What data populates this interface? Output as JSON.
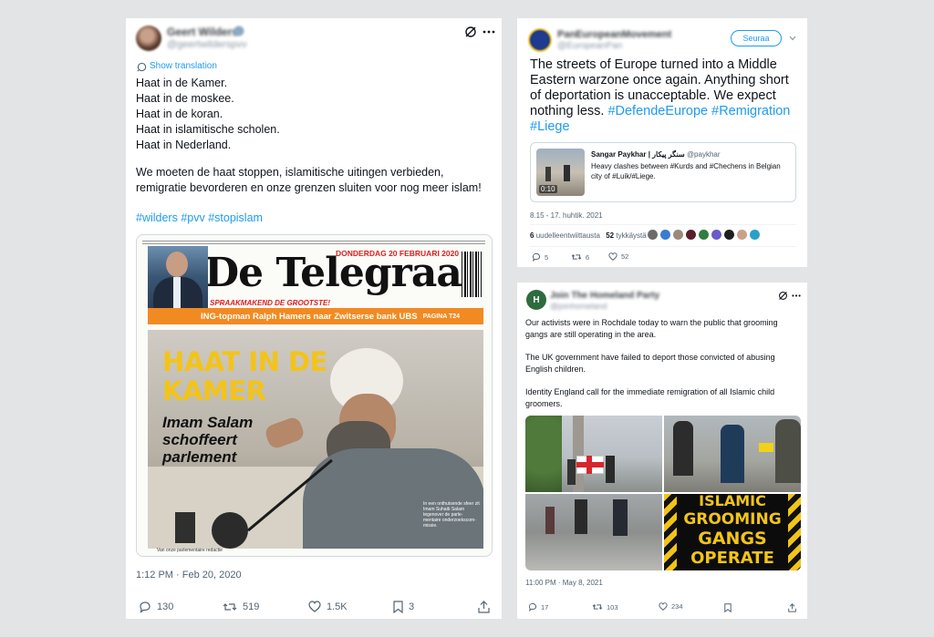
{
  "tweet1": {
    "author_name": "Geert Wilders",
    "author_handle": "@geertwilderspvv",
    "show_translation": "Show translation",
    "lines": [
      "Haat in de Kamer.",
      "Haat in de moskee.",
      "Haat in de koran.",
      "Haat in islamitische scholen.",
      "Haat in Nederland."
    ],
    "paragraph": "We moeten de haat stoppen, islamitische uitingen verbieden, remigratie bevorderen en onze grenzen sluiten voor nog meer islam!",
    "hashtags": "#wilders #pvv #stopislam",
    "newspaper": {
      "masthead": "De Telegraaf",
      "date": "DONDERDAG 20 FEBRUARI 2020",
      "tagline": "SPRAAKMAKEND DE GROOTSTE!",
      "teaser": "ING-topman Ralph Hamers naar Zwitserse bank UBS",
      "teaser_page": "PAGINA T24",
      "headline_1": "HAAT IN DE",
      "headline_2": "KAMER",
      "sub_1": "Imam Salam",
      "sub_2": "schoffeert",
      "sub_3": "parlement",
      "caption": "In een onthutsende sfeer zit Imam Suhaib Salam tegenover de parle- mentaire onderzoekscom- missie.",
      "byline": "Van onze parlementaire redactie"
    },
    "timestamp": "1:12 PM · Feb 20, 2020",
    "replies": "130",
    "retweets": "519",
    "likes": "1.5K",
    "bookmarks": "3"
  },
  "tweet2": {
    "author_name": "PanEuropeanMovement",
    "author_handle": "@EuropeanPan",
    "follow_label": "Seuraa",
    "text": "The streets of Europe turned into a Middle Eastern warzone once again. Anything short of deportation is unacceptable. We expect nothing less.",
    "hashtags": "#DefendeEurope #Remigration #Liege",
    "quote": {
      "name": "Sangar Paykhar |",
      "name_alt": "سنگر پیکار",
      "handle": "@paykhar",
      "text": "Heavy clashes between #Kurds and #Chechens in Belgian city of #Luik/#Liege.",
      "video_time": "0:10"
    },
    "timestamp": "8.15 - 17. huhtik. 2021",
    "retweets_count": "6",
    "retweets_label": "uudelleentwiittausta",
    "likes_count": "52",
    "likes_label": "tykkäystä",
    "replies": "5",
    "retweets": "6",
    "likes": "52"
  },
  "tweet3": {
    "author_name": "Join The Homeland Party",
    "author_handle": "@joinhomeland",
    "para_1": "Our activists were in Rochdale today to warn the public that grooming gangs are still operating in the area.",
    "para_2": "The UK government have failed to deport those convicted of abusing English children.",
    "para_3": "Identity England call for the immediate remigration of all Islamic child groomers.",
    "banner_1": "ISLAMIC",
    "banner_2": "GROOMING",
    "banner_3": "GANGS",
    "banner_4": "OPERATE",
    "timestamp": "11:00 PM · May 8, 2021",
    "replies": "17",
    "retweets": "103",
    "likes": "234"
  },
  "colors": {
    "link": "#1d9bf0",
    "muted": "#536471",
    "telegraaf_red": "#d9201f",
    "telegraaf_orange": "#f28a22",
    "headline_yellow": "#f3c417"
  }
}
